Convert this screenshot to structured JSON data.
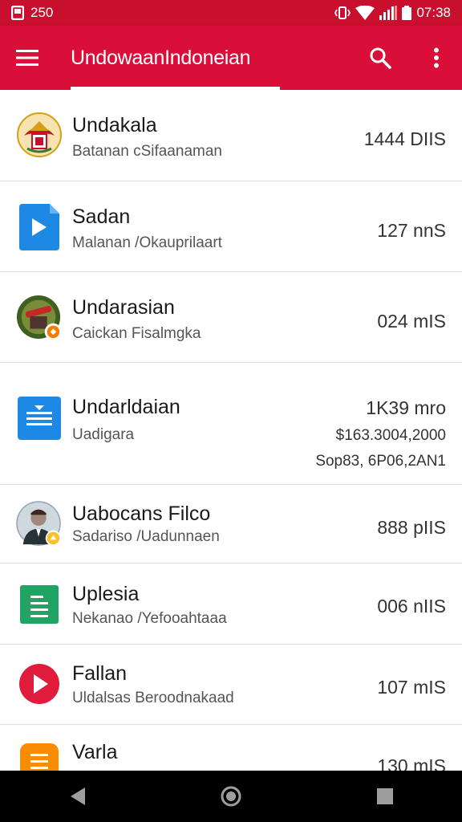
{
  "status_bar": {
    "left_text": "250",
    "time": "07:38"
  },
  "app_bar": {
    "title": "UndowaanIndoneian"
  },
  "list": [
    {
      "title": "Undakala",
      "subtitle": "Batanan cSifaanaman",
      "size": "1444 DIIS",
      "icon": "emblem-icon"
    },
    {
      "title": "Sadan",
      "subtitle": "Malanan /Okauprilaart",
      "size": "127 nnS",
      "icon": "blue-folder-play-icon"
    },
    {
      "title": "Undarasian",
      "subtitle": "Caickan Fisalmgka",
      "size": "024 mIS",
      "icon": "photo-badge-icon"
    },
    {
      "title": "Undarldaian",
      "subtitle": "Uadigara",
      "size": "1K39 mro",
      "extra1": "$163.3004,2000",
      "extra2": "Sop83, 6P06,2AN1",
      "icon": "blue-document-icon"
    },
    {
      "title": "Uabocans Filco",
      "subtitle": "Sadariso /Uadunnaen",
      "size": "888 pIIS",
      "icon": "person-avatar-icon"
    },
    {
      "title": "Uplesia",
      "subtitle": "Nekanao /Yefooahtaaa",
      "size": "006 nIIS",
      "icon": "green-sheet-icon"
    },
    {
      "title": "Fallan",
      "subtitle": "Uldalsas Beroodnakaad",
      "size": "107 mIS",
      "icon": "red-play-icon"
    },
    {
      "title": "Varla",
      "subtitle": "",
      "size": "130 mIS",
      "icon": "orange-document-icon"
    }
  ],
  "colors": {
    "primary": "#d90f3a",
    "status": "#c8102e",
    "divider": "#dedede"
  }
}
